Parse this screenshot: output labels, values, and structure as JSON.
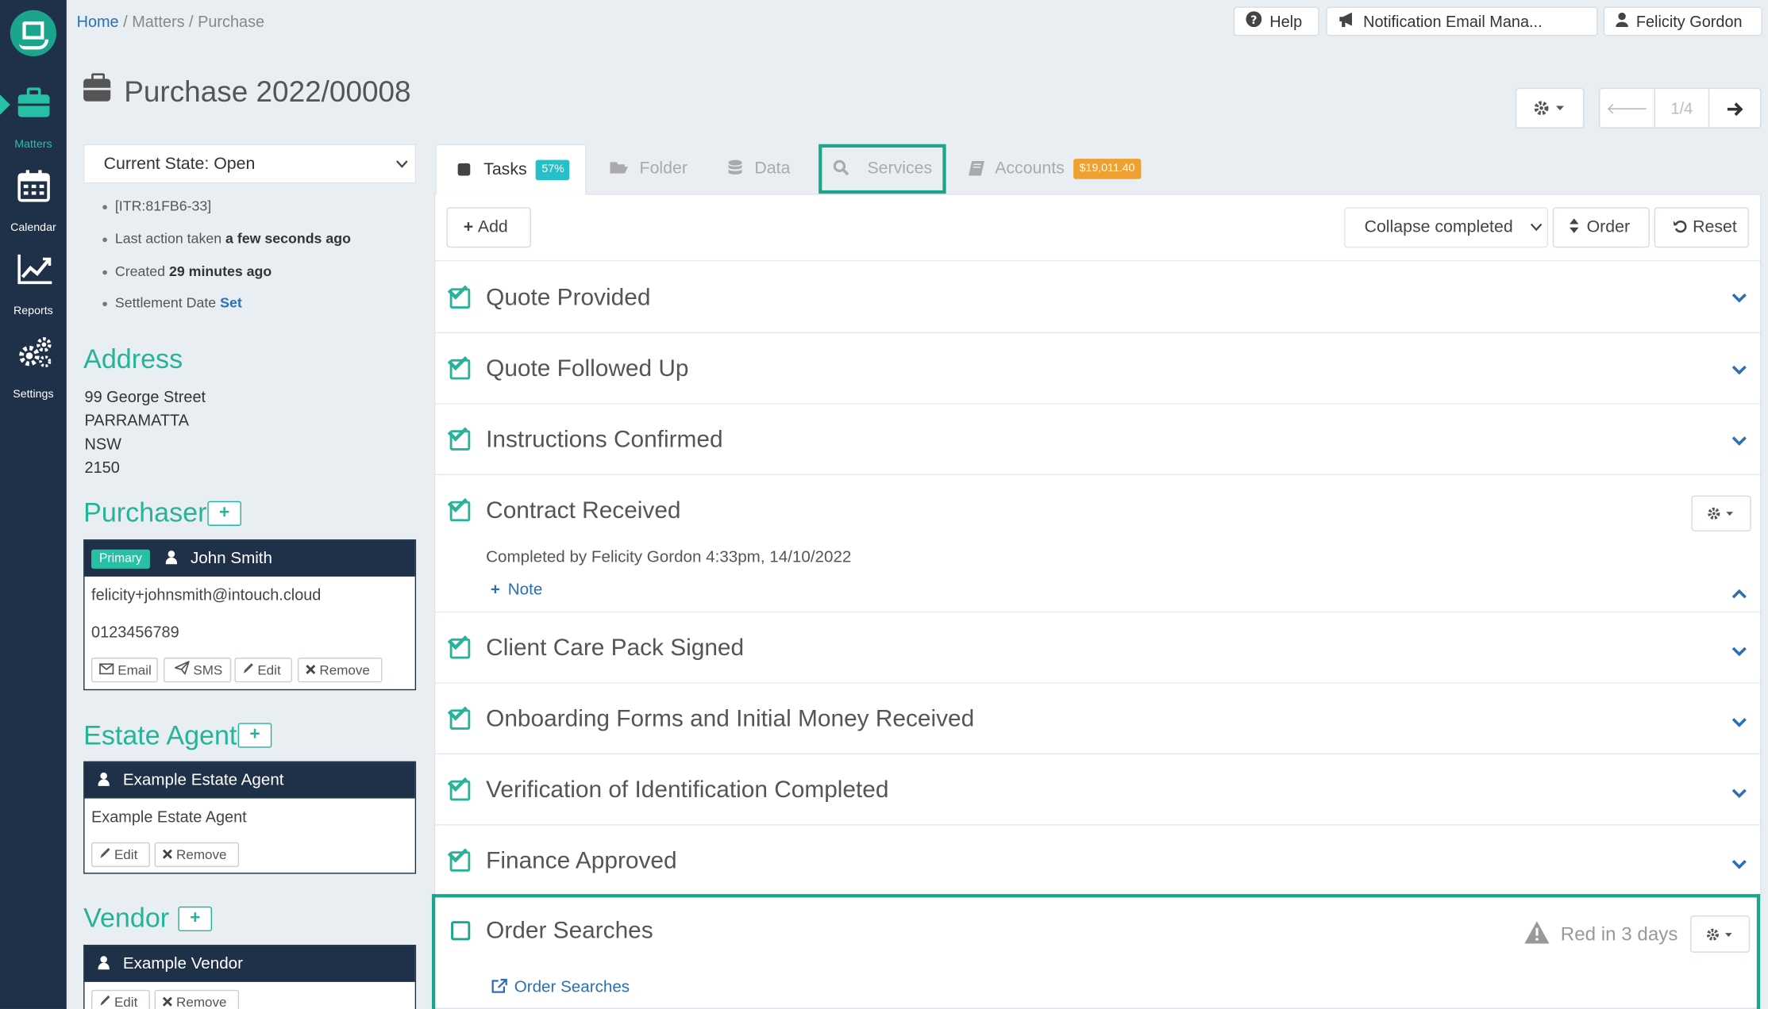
{
  "sidebar": {
    "items": [
      {
        "label": "Matters",
        "icon": "briefcase-icon"
      },
      {
        "label": "Calendar",
        "icon": "calendar-icon"
      },
      {
        "label": "Reports",
        "icon": "chart-icon"
      },
      {
        "label": "Settings",
        "icon": "gears-icon"
      }
    ]
  },
  "breadcrumb": {
    "home": "Home",
    "sep": "/",
    "matters": "Matters",
    "current": "Purchase"
  },
  "topbar": {
    "help": "Help",
    "notification": "Notification Email Mana...",
    "user": "Felicity Gordon"
  },
  "page": {
    "title": "Purchase 2022/00008"
  },
  "pager": {
    "position": "1/4"
  },
  "left": {
    "state": "Current State: Open",
    "meta": {
      "id": "[ITR:81FB6-33]",
      "last_action_label": "Last action taken",
      "last_action_value": "a few seconds ago",
      "created_label": "Created",
      "created_value": "29 minutes ago",
      "settlement_label": "Settlement Date",
      "settlement_value": "Set"
    },
    "address": {
      "heading": "Address",
      "lines": [
        "99 George Street",
        "PARRAMATTA",
        "NSW",
        "2150"
      ]
    },
    "purchaser": {
      "heading": "Purchaser",
      "badge": "Primary",
      "name": "John Smith",
      "email": "felicity+johnsmith@intouch.cloud",
      "phone": "0123456789",
      "buttons": {
        "email": "Email",
        "sms": "SMS",
        "edit": "Edit",
        "remove": "Remove"
      }
    },
    "estate_agent": {
      "heading": "Estate Agent",
      "name": "Example Estate Agent",
      "body": "Example Estate Agent",
      "buttons": {
        "edit": "Edit",
        "remove": "Remove"
      }
    },
    "vendor": {
      "heading": "Vendor",
      "name": "Example Vendor",
      "buttons": {
        "edit": "Edit",
        "remove": "Remove"
      }
    }
  },
  "tabs": [
    {
      "label": "Tasks",
      "badge": "57%"
    },
    {
      "label": "Folder"
    },
    {
      "label": "Data"
    },
    {
      "label": "Services"
    },
    {
      "label": "Accounts",
      "badge": "$19,011.40"
    }
  ],
  "toolbar": {
    "add": "Add",
    "collapse": "Collapse completed",
    "order": "Order",
    "reset": "Reset"
  },
  "tasks": [
    {
      "title": "Quote Provided",
      "done": true
    },
    {
      "title": "Quote Followed Up",
      "done": true
    },
    {
      "title": "Instructions Confirmed",
      "done": true
    },
    {
      "title": "Contract Received",
      "done": true,
      "completed": "Completed by Felicity Gordon 4:33pm, 14/10/2022",
      "note": "Note"
    },
    {
      "title": "Client Care Pack Signed",
      "done": true
    },
    {
      "title": "Onboarding Forms and Initial Money Received",
      "done": true
    },
    {
      "title": "Verification of Identification Completed",
      "done": true
    },
    {
      "title": "Finance Approved",
      "done": true
    },
    {
      "title": "Order Searches",
      "done": false,
      "warning": "Red in 3 days",
      "link": "Order Searches"
    }
  ],
  "colors": {
    "sidebar": "#1e3148",
    "accent": "#27b39a",
    "link": "#2a6fb8",
    "tasks_badge": "#27c0c9",
    "accounts_badge": "#f0a030"
  }
}
